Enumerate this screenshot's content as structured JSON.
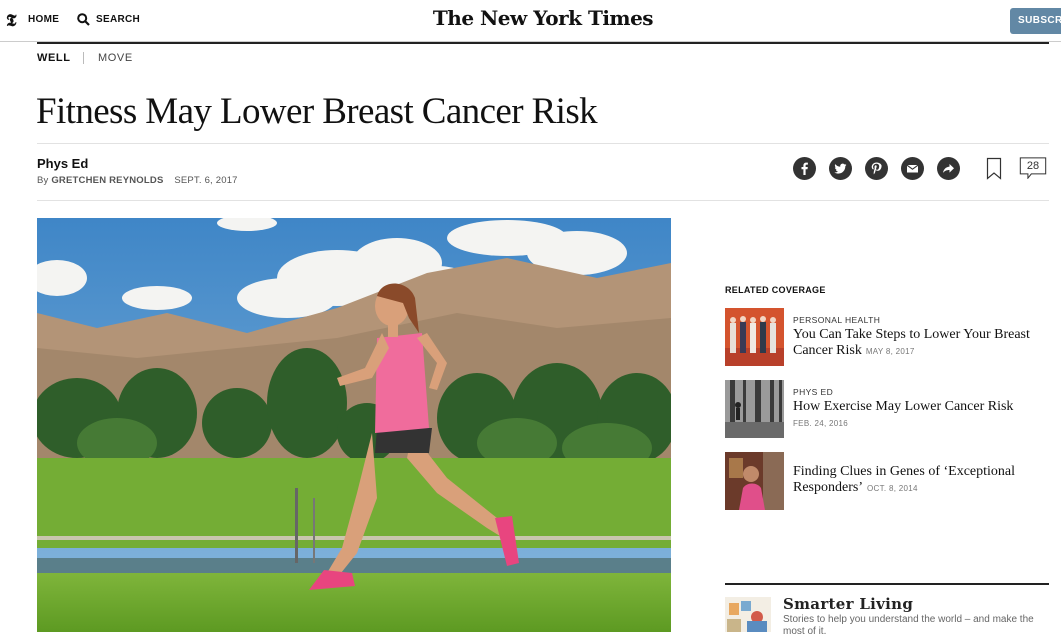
{
  "nav": {
    "logo_glyph": "𝕿",
    "home_label": "HOME",
    "search_label": "SEARCH",
    "masthead": "The New York Times",
    "subscribe_label": "SUBSCRIBE"
  },
  "section": {
    "primary": "WELL",
    "secondary": "MOVE"
  },
  "article": {
    "headline": "Fitness May Lower Breast Cancer Risk",
    "kicker": "Phys Ed",
    "byline_prefix": "By",
    "author": "GRETCHEN REYNOLDS",
    "date": "SEPT. 6, 2017",
    "comment_count": "28",
    "share_icons": [
      "facebook-icon",
      "twitter-icon",
      "pinterest-icon",
      "email-icon",
      "share-arrow-icon"
    ]
  },
  "related": {
    "title": "RELATED COVERAGE",
    "items": [
      {
        "kicker": "PERSONAL HEALTH",
        "headline": "You Can Take Steps to Lower Your Breast Cancer Risk",
        "date": "MAY 8, 2017"
      },
      {
        "kicker": "PHYS ED",
        "headline": "How Exercise May Lower Cancer Risk",
        "date": "FEB. 24, 2016"
      },
      {
        "kicker": "",
        "headline": "Finding Clues in Genes of ‘Exceptional Responders’",
        "date": "OCT. 8, 2014"
      }
    ]
  },
  "smarter_living": {
    "title": "Smarter Living",
    "description": "Stories to help you understand the world – and make the most of it."
  },
  "colors": {
    "subscribe_bg": "#6288a5",
    "text": "#111111",
    "share_icon_bg": "#333333"
  }
}
